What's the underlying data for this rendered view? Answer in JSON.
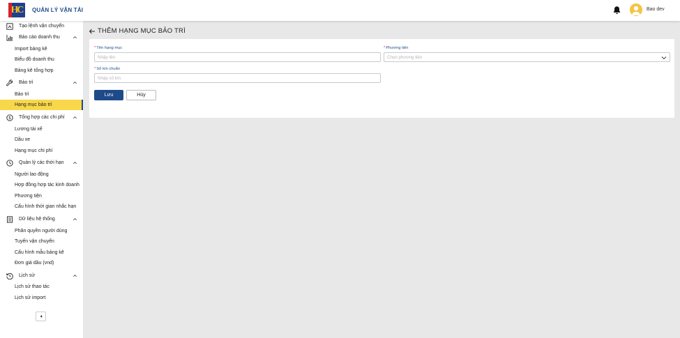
{
  "header": {
    "app_title": "QUẢN LÝ VẬN TẢI",
    "logo_icon": "company-logo",
    "notification_icon": "bell-icon",
    "user_name": "Bao dev",
    "avatar_color": "#f6c342"
  },
  "sidebar": {
    "top_item": "Tạo lệnh vận chuyển",
    "groups": [
      {
        "label": "Báo cáo doanh thu",
        "icon": "chart-icon",
        "items": [
          "Import bảng kê",
          "Biểu đồ doanh thu",
          "Bảng kê tổng hợp"
        ]
      },
      {
        "label": "Bảo trì",
        "icon": "wrench-icon",
        "items": [
          "Bảo trì",
          "Hạng mục bảo trì"
        ]
      },
      {
        "label": "Tổng hợp các chi phí",
        "icon": "dollar-icon",
        "items": [
          "Lương tài xế",
          "Dầu xe",
          "Hạng mục chi phí"
        ]
      },
      {
        "label": "Quản lý các thời hạn",
        "icon": "clock-icon",
        "items": [
          "Người lao động",
          "Hợp đồng hợp tác kinh doanh",
          "Phương tiện",
          "Cấu hình thời gian nhắc hạn"
        ]
      },
      {
        "label": "Dữ liệu hệ thống",
        "icon": "document-icon",
        "items": [
          "Phân quyền người dùng",
          "Tuyến vận chuyển",
          "Cấu hình mẫu bảng kê",
          "Đơn giá dầu (vnd)"
        ]
      },
      {
        "label": "Lịch sử",
        "icon": "history-icon",
        "items": [
          "Lịch sử thao tác",
          "Lịch sử import"
        ]
      }
    ],
    "active_item": "Hạng mục bảo trì",
    "active_color": "#f8d74a"
  },
  "page": {
    "title": "THÊM HẠNG MỤC BẢO TRÌ"
  },
  "form": {
    "name_label": "Tên hạng mục",
    "name_placeholder": "Nhập tên",
    "vehicle_label": "Phương tiện",
    "vehicle_placeholder": "Chọn phương tiện",
    "km_label": "Số km chuẩn",
    "km_placeholder": "Nhập số km",
    "required_mark": "*",
    "save_label": "Lưu",
    "cancel_label": "Hủy"
  },
  "colors": {
    "primary": "#1f4a8a",
    "required": "#e23030"
  }
}
